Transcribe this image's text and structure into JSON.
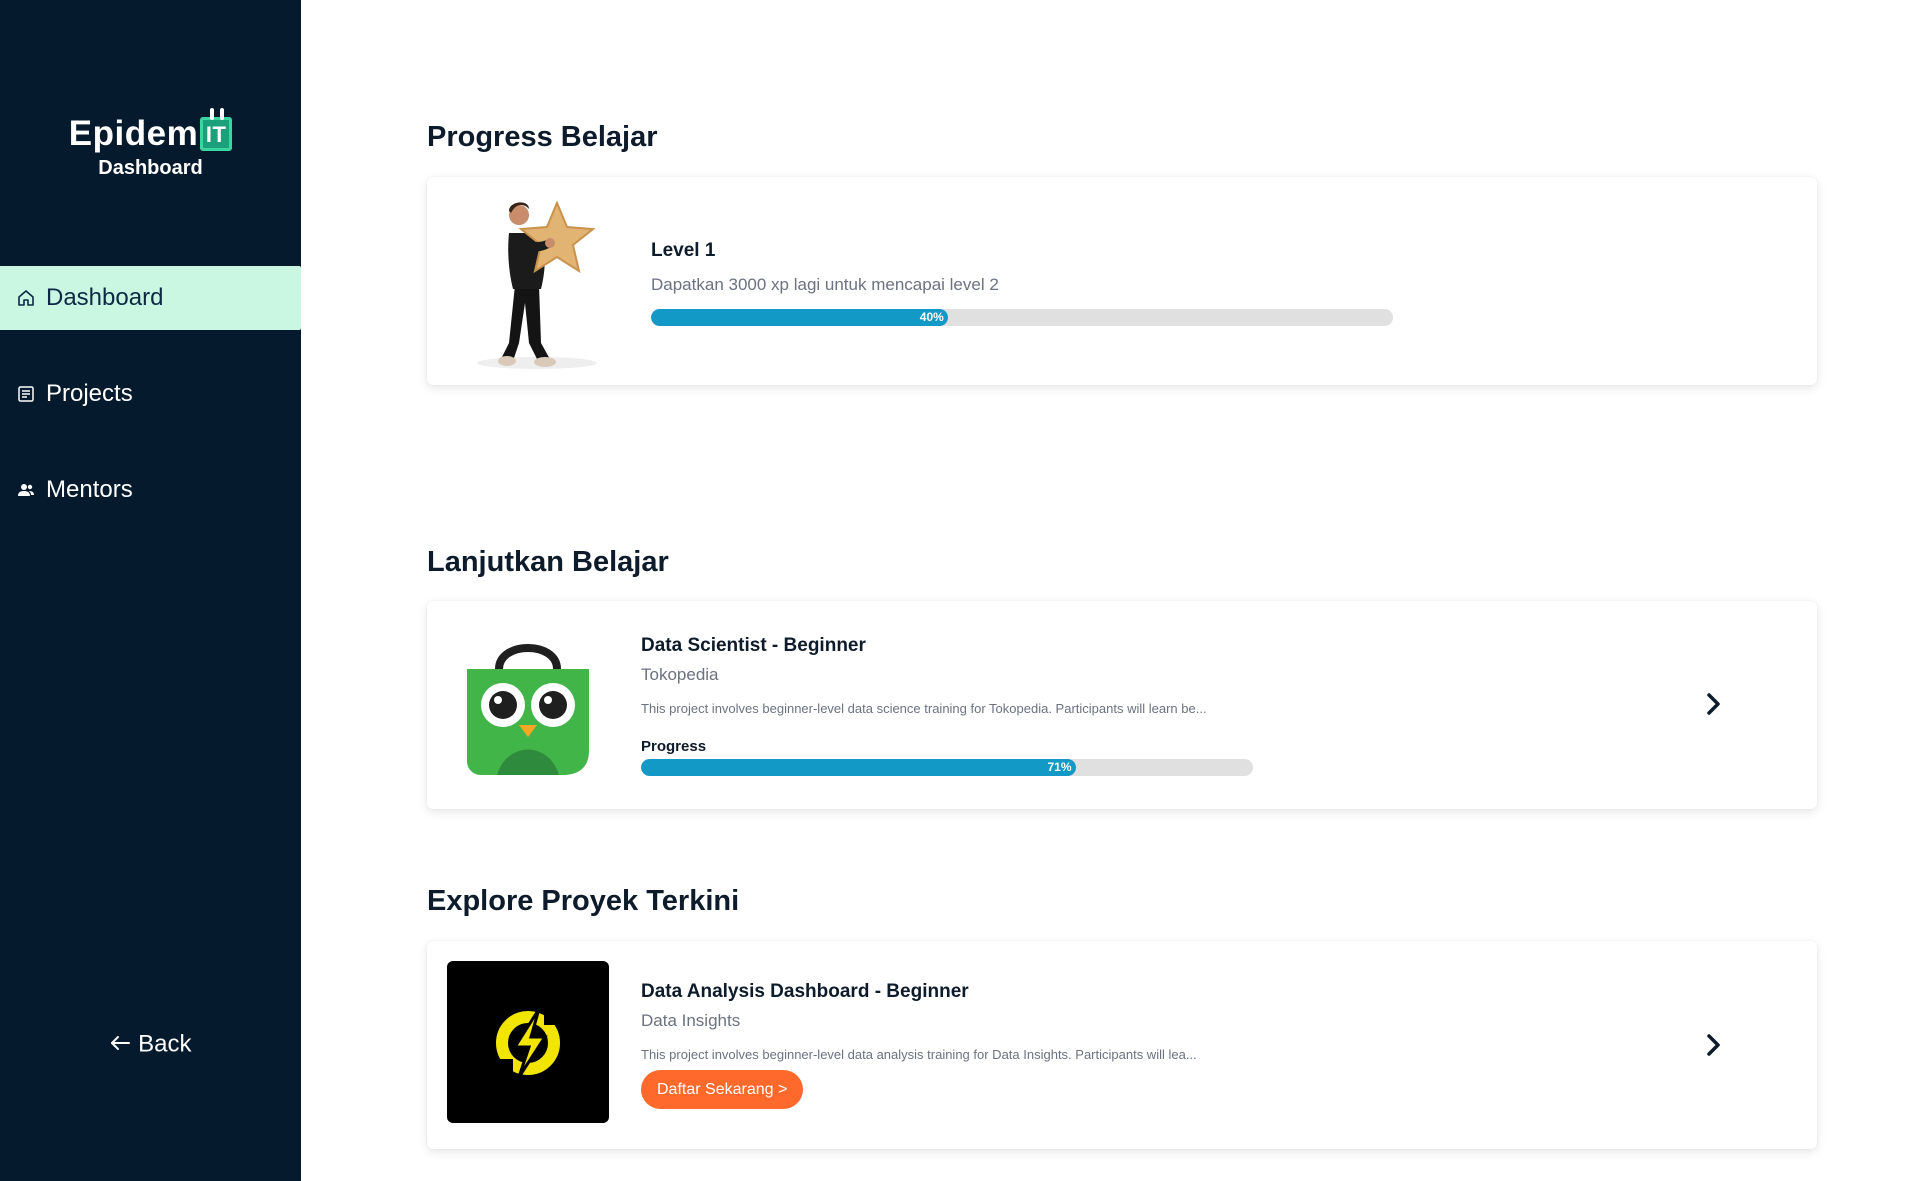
{
  "sidebar": {
    "brand": {
      "logo_text": "Epidem",
      "logo_mark": "IT",
      "subtitle": "Dashboard"
    },
    "items": [
      {
        "label": "Dashboard",
        "icon": "home-icon",
        "active": true
      },
      {
        "label": "Projects",
        "icon": "document-icon",
        "active": false
      },
      {
        "label": "Mentors",
        "icon": "users-icon",
        "active": false
      }
    ],
    "back_label": "Back"
  },
  "progress": {
    "section_title": "Progress Belajar",
    "level_title": "Level 1",
    "description": "Dapatkan 3000 xp lagi untuk mencapai level 2",
    "percent": 40,
    "percent_label": "40%"
  },
  "continue": {
    "section_title": "Lanjutkan Belajar",
    "course": {
      "title": "Data Scientist - Beginner",
      "company": "Tokopedia",
      "description": "This project involves beginner-level data science training for Tokopedia. Participants will learn be...",
      "progress_label": "Progress",
      "percent": 71,
      "percent_label": "71%"
    }
  },
  "explore": {
    "section_title": "Explore Proyek Terkini",
    "project": {
      "title": "Data Analysis Dashboard - Beginner",
      "company": "Data Insights",
      "description": "This project involves beginner-level data analysis training for Data Insights. Participants will lea...",
      "cta_label": "Daftar Sekarang >"
    }
  },
  "colors": {
    "sidebar_bg": "#061a2e",
    "active_item_bg": "#c9f7e1",
    "progress_fill": "#1399c6",
    "cta_bg": "#ff6a2c"
  }
}
